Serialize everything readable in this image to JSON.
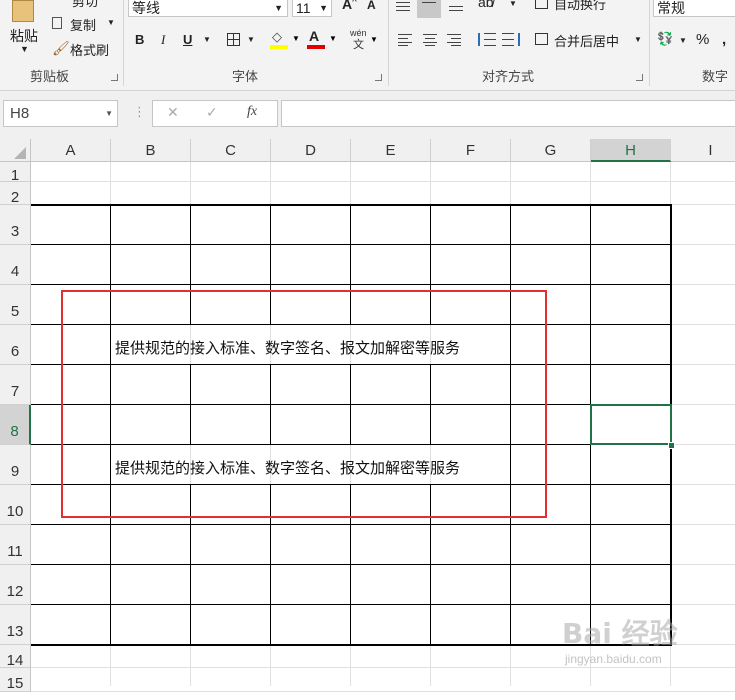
{
  "clipboard": {
    "paste_label": "粘贴",
    "cut_label": "剪切",
    "copy_label": "复制",
    "format_painter_label": "格式刷",
    "group_label": "剪贴板"
  },
  "font": {
    "font_name": "等线",
    "font_size": "11",
    "bold": "B",
    "italic": "I",
    "underline": "U",
    "wen_label": "wén",
    "group_label": "字体"
  },
  "alignment": {
    "wrap_text_label": "自动换行",
    "merge_center_label": "合并后居中",
    "group_label": "对齐方式"
  },
  "number": {
    "format_value": "常规",
    "percent_label": "%",
    "group_label": "数字"
  },
  "colors": {
    "highlight": "#ffff00",
    "font_color": "#e00000",
    "selection": "#217346",
    "annotation_box": "#e03030"
  },
  "formula_bar": {
    "name_box": "H8",
    "cancel_icon": "✕",
    "enter_icon": "✓",
    "fx_label": "fx",
    "formula": ""
  },
  "grid": {
    "columns": [
      "A",
      "B",
      "C",
      "D",
      "E",
      "F",
      "G",
      "H",
      "I"
    ],
    "rows": [
      "1",
      "2",
      "3",
      "4",
      "5",
      "6",
      "7",
      "8",
      "9",
      "10",
      "11",
      "12",
      "13",
      "14",
      "15"
    ],
    "active_cell": "H8",
    "cells": {
      "B6": "提供规范的接入标准、数字签名、报文加解密等服务",
      "B9": "提供规范的接入标准、数字签名、报文加解密等服务"
    }
  },
  "watermark": {
    "text": "Bai 经验",
    "url_text": "jingyan.baidu.com"
  }
}
